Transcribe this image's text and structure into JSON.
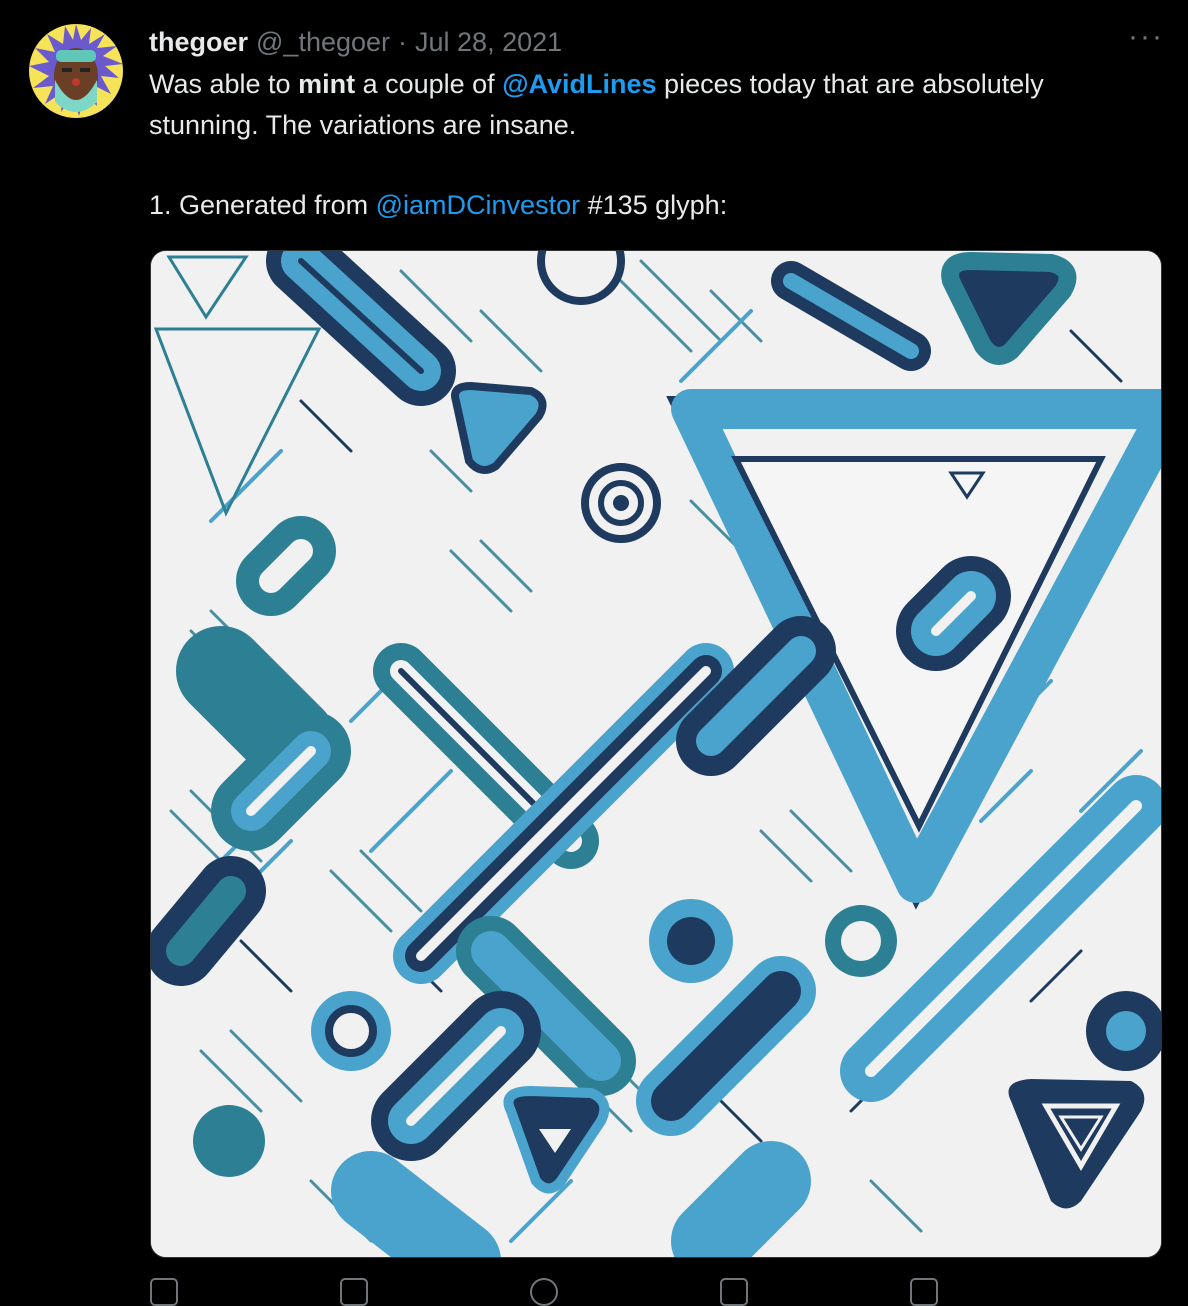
{
  "tweet": {
    "display_name": "thegoer",
    "handle": "@_thegoer",
    "separator": "·",
    "date": "Jul 28, 2021",
    "more_label": "···",
    "line1": {
      "t1": "Was able to ",
      "bold": "mint",
      "t2": " a couple of ",
      "mention": "@AvidLines",
      "t3": " pieces today that are absolutely stunning. The variations are insane."
    },
    "line2": {
      "t1": "1. Generated from ",
      "mention": "@iamDCinvestor",
      "t2": " #135 glyph:"
    }
  },
  "colors": {
    "background": "#000000",
    "text": "#e7e9ea",
    "muted": "#71767b",
    "link": "#1d9bf0",
    "art_light": "#4aa3cc",
    "art_teal": "#2d7f94",
    "art_navy": "#1e3a5f",
    "art_bg": "#f1f1f1"
  },
  "actions": [
    "reply-icon",
    "retweet-icon",
    "like-icon",
    "share-icon"
  ]
}
